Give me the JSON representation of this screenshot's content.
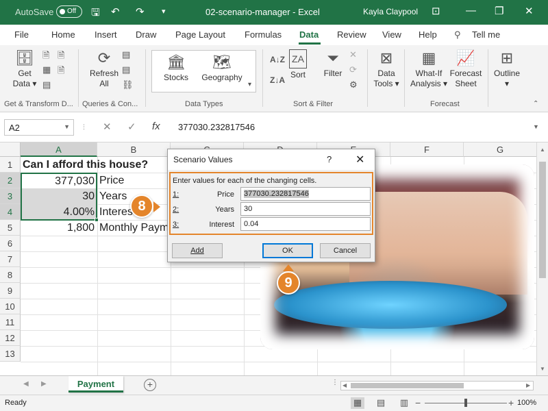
{
  "titlebar": {
    "autosave_label": "AutoSave",
    "autosave_state": "Off",
    "doc_title": "02-scenario-manager  -  Excel",
    "user": "Kayla Claypool"
  },
  "tabs": [
    "File",
    "Home",
    "Insert",
    "Draw",
    "Page Layout",
    "Formulas",
    "Data",
    "Review",
    "View",
    "Help",
    "Tell me"
  ],
  "active_tab": "Data",
  "ribbon": {
    "get_data": "Get Data",
    "refresh_all": "Refresh All",
    "stocks": "Stocks",
    "geography": "Geography",
    "sort": "Sort",
    "filter": "Filter",
    "data_tools": "Data Tools",
    "whatif": "What-If Analysis",
    "forecast_sheet": "Forecast Sheet",
    "outline": "Outline",
    "groups": {
      "get_transform": "Get & Transform D...",
      "queries": "Queries & Con...",
      "data_types": "Data Types",
      "sort_filter": "Sort & Filter",
      "forecast": "Forecast"
    }
  },
  "formula_bar": {
    "name_box": "A2",
    "formula": "377030.232817546",
    "fx": "fx"
  },
  "grid": {
    "columns": [
      "A",
      "B",
      "C",
      "D",
      "E",
      "F",
      "G"
    ],
    "rows": [
      "1",
      "2",
      "3",
      "4",
      "5",
      "6",
      "7",
      "8",
      "9",
      "10",
      "11",
      "12",
      "13"
    ],
    "cells": {
      "A1": "Can I afford this house?",
      "A2": "377,030",
      "B2": "Price",
      "A3": "30",
      "B3": "Years",
      "A4": "4.00%",
      "B4": "Interest",
      "A5": "1,800",
      "B5": "Monthly Payment"
    }
  },
  "dialog": {
    "title": "Scenario Values",
    "help": "?",
    "close": "✕",
    "prompt": "Enter values for each of the changing cells.",
    "fields": [
      {
        "num": "1:",
        "label": "Price",
        "value": "377030.232817546"
      },
      {
        "num": "2:",
        "label": "Years",
        "value": "30"
      },
      {
        "num": "3:",
        "label": "Interest",
        "value": "0.04"
      }
    ],
    "add_label": "Add",
    "ok_label": "OK",
    "cancel_label": "Cancel"
  },
  "callouts": {
    "step8": "8",
    "step9": "9"
  },
  "sheet_tab": "Payment",
  "status": {
    "ready": "Ready",
    "zoom": "100%"
  }
}
